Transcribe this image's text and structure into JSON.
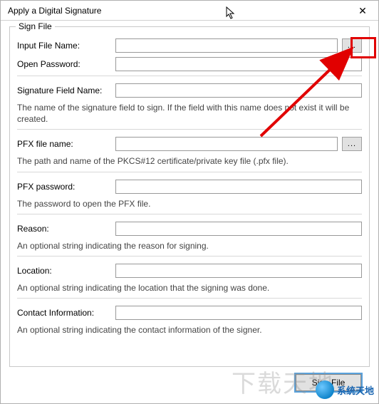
{
  "window": {
    "title": "Apply a Digital Signature",
    "close_glyph": "✕"
  },
  "group": {
    "label": "Sign File"
  },
  "inputFile": {
    "label": "Input File Name:",
    "value": "",
    "browse": "..."
  },
  "openPassword": {
    "label": "Open Password:",
    "value": ""
  },
  "sigField": {
    "label": "Signature Field Name:",
    "value": "",
    "help": "The name of the signature field to sign. If the field with this name does not exist it will be created."
  },
  "pfxFile": {
    "label": "PFX file name:",
    "value": "",
    "browse": "...",
    "help": "The path and name of the PKCS#12 certificate/private key file (.pfx file)."
  },
  "pfxPassword": {
    "label": "PFX password:",
    "value": "",
    "help": "The password to open the PFX file."
  },
  "reason": {
    "label": "Reason:",
    "value": "",
    "help": "An optional string indicating the reason for signing."
  },
  "location": {
    "label": "Location:",
    "value": "",
    "help": "An optional string indicating the location that the signing was done."
  },
  "contact": {
    "label": "Contact Information:",
    "value": "",
    "help": "An optional string indicating the contact information of the signer."
  },
  "button": {
    "label": "Sign File"
  },
  "watermark": {
    "text": "下载天地"
  },
  "logo": {
    "text": "系统天地"
  }
}
